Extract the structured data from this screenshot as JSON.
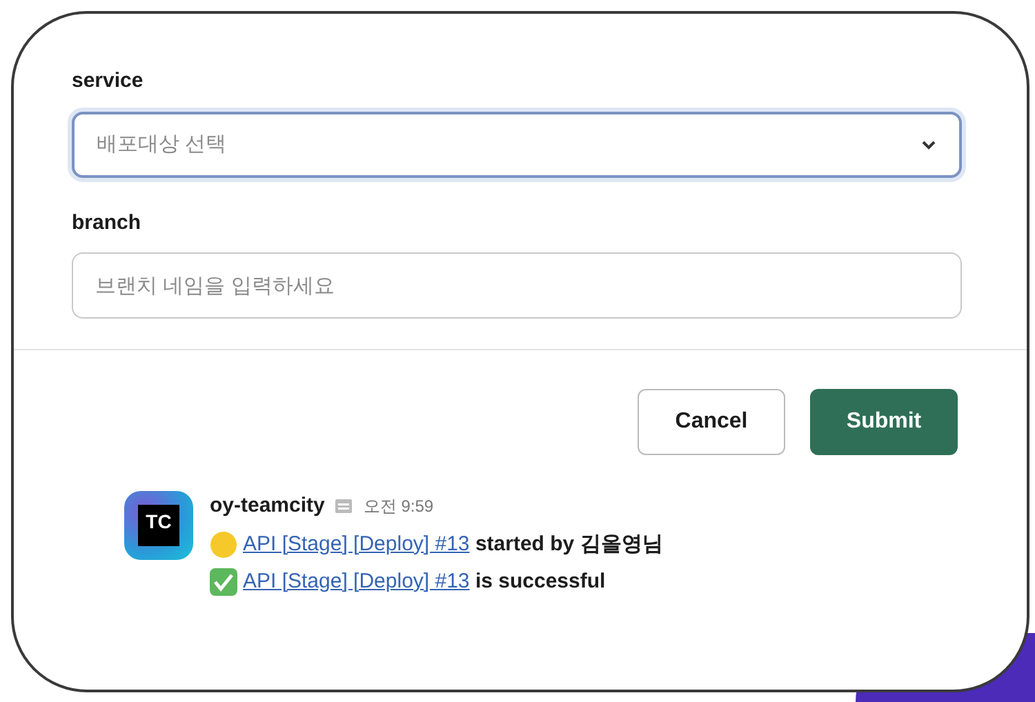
{
  "form": {
    "fields": [
      {
        "kind": "select",
        "label": "service",
        "placeholder": "배포대상 선택",
        "focused": true
      },
      {
        "kind": "text",
        "label": "branch",
        "placeholder": "브랜치 네임을 입력하세요",
        "focused": false
      }
    ],
    "buttons": [
      {
        "label": "Cancel",
        "kind": "secondary"
      },
      {
        "label": "Submit",
        "kind": "primary"
      }
    ]
  },
  "message": {
    "avatar": "TC",
    "sender": "oy-teamcity",
    "time": "오전 9:59",
    "lines": [
      {
        "kind": "pending",
        "link": "API [Stage] [Deploy] #13",
        "text": "started by 김올영님"
      },
      {
        "kind": "success",
        "link": "API [Stage] [Deploy] #13",
        "text": "is successful"
      }
    ]
  }
}
